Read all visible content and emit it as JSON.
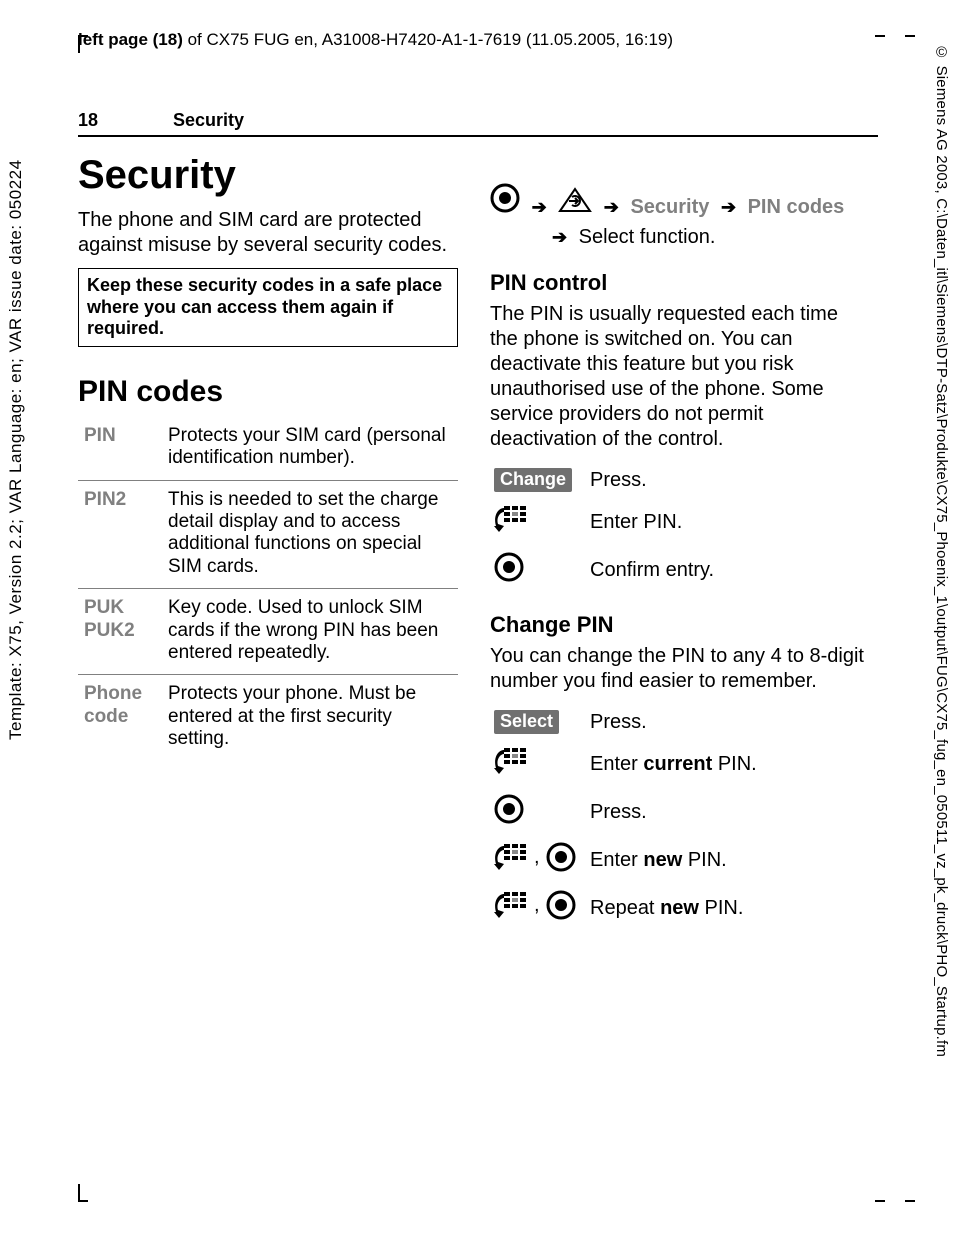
{
  "meta": {
    "top_line_prefix": "left page (18)",
    "top_line_rest": " of CX75 FUG en, A31008-H7420-A1-1-7619 (11.05.2005, 16:19)",
    "left_margin": "Template: X75, Version 2.2; VAR Language: en; VAR issue date: 050224",
    "right_margin": "© Siemens AG 2003, C:\\Daten_itl\\Siemens\\DTP-Satz\\Produkte\\CX75_Phoenix_1\\output\\FUG\\CX75_fug_en_050511_vz_pk_druck\\PHO_Startup.fm"
  },
  "running_head": {
    "page": "18",
    "section": "Security"
  },
  "left_col": {
    "h1": "Security",
    "intro": "The phone and SIM card are protected against misuse by several security codes.",
    "note": "Keep these security codes in a safe place where you can access them again if required.",
    "h2": "PIN codes",
    "defs": [
      {
        "k": "PIN",
        "v": "Protects your SIM card (personal identification number)."
      },
      {
        "k": "PIN2",
        "v": "This is needed to set the charge detail display and to access additional functions on special SIM cards."
      },
      {
        "k": "PUK\nPUK2",
        "v": "Key code. Used to unlock SIM cards if the wrong PIN has been entered repeatedly."
      },
      {
        "k": "Phone code",
        "v": "Protects your phone. Must be entered at the first security setting."
      }
    ]
  },
  "right_col": {
    "nav": {
      "sec": "Security",
      "pin": "PIN codes",
      "tail": "Select function."
    },
    "pin_control": {
      "h": "PIN control",
      "p": "The PIN is usually requested each time the phone is switched on. You can deactivate this feature but you risk unauthorised use of the phone. Some service providers do not permit deactivation of the control.",
      "s1_key": "Change",
      "s1_tx": "Press.",
      "s2_tx": "Enter PIN.",
      "s3_tx": "Confirm entry."
    },
    "change_pin": {
      "h": "Change PIN",
      "p": "You can change the PIN to any 4 to 8-digit number you find easier to remember.",
      "s1_key": "Select",
      "s1_tx": "Press.",
      "s2_pre": "Enter ",
      "s2_b": "current",
      "s2_post": " PIN.",
      "s3_tx": "Press.",
      "s4_pre": "Enter ",
      "s4_b": "new",
      "s4_post": " PIN.",
      "s5_pre": "Repeat ",
      "s5_b": "new",
      "s5_post": " PIN."
    }
  }
}
